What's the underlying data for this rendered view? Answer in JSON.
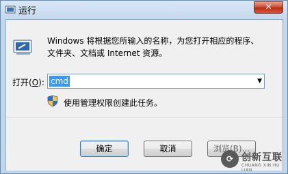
{
  "window": {
    "title": "运行",
    "close_label": "✕"
  },
  "dialog": {
    "description_line1": "Windows 将根据您所输入的名称，为您打开相应的程序、",
    "description_line2": "文件夹、文档或 Internet 资源。",
    "open_label_prefix": "打开(",
    "open_label_mnemonic": "O",
    "open_label_suffix": "):",
    "command_value": "cmd",
    "admin_note": "使用管理权限创建此任务。"
  },
  "buttons": {
    "ok": "确定",
    "cancel": "取消",
    "browse": "浏览(B)..."
  },
  "watermark": {
    "name": "创新互联",
    "sub": "CHUANG XIN HU LIAN"
  }
}
